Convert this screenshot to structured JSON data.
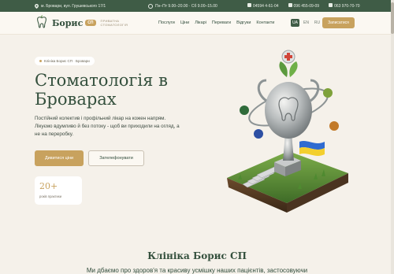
{
  "topbar": {
    "address": "м. Бровари, вул. Грушевського 17/1",
    "hours": "Пн–Пт 9.00–20.00 · Сб 9.00–15.00",
    "phones": [
      "04594 4-61-04",
      "096 455-09-09",
      "063 970-70-70"
    ]
  },
  "nav": {
    "brand": "Борис",
    "brand_badge": "СП",
    "brand_sub_1": "ПРИВАТНА",
    "brand_sub_2": "СТОМАТОЛОГІЯ",
    "menu": [
      "Послуги",
      "Ціни",
      "Лікарі",
      "Переваги",
      "Відгуки",
      "Контакти"
    ],
    "languages": [
      "UA",
      "EN",
      "RU"
    ],
    "active_language": "UA",
    "signup_label": "Записатися"
  },
  "hero": {
    "tag": "Клініка Борис СП · Бровари",
    "title_line1": "Стоматологія в",
    "title_line2": "Броварах",
    "description": "Постійний колектив і профільний лікар на кожен напрям. Лікуємо вдумливо й без потоку - щоб ви приходили на огляд, а не на переробку.",
    "primary_button": "Дивитися ціни",
    "secondary_button": "Зателефонувати",
    "stat_value": "20+",
    "stat_label": "років практики"
  },
  "section": {
    "title": "Клініка Борис СП",
    "text": "Ми дбаємо про здоров'я та красиву усмішку наших пацієнтів, застосовуючи"
  },
  "colors": {
    "accent": "#c8a25e",
    "brand_green": "#3f5c46",
    "background": "#f5f1ea"
  }
}
